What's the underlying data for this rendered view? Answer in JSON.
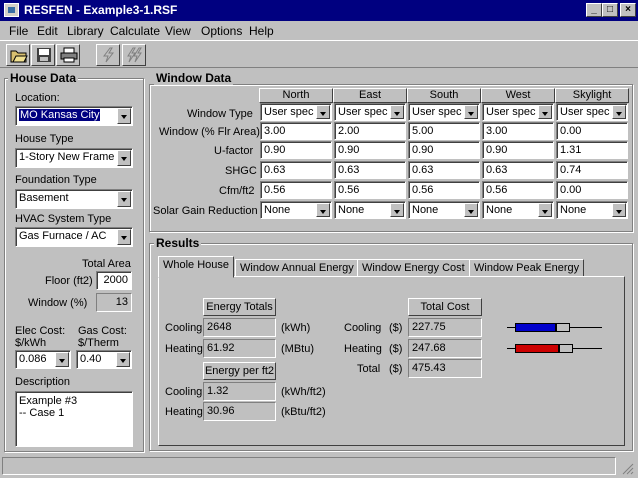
{
  "window": {
    "title": "RESFEN - Example3-1.RSF",
    "min": "_",
    "max": "□",
    "close": "×"
  },
  "menu": [
    "File",
    "Edit",
    "Library",
    "Calculate",
    "View",
    "Options",
    "Help"
  ],
  "toolbar": [
    "open-icon",
    "save-icon",
    "print-icon",
    "calculate-icon",
    "calculate-all-icon"
  ],
  "house": {
    "title": "House Data",
    "location_label": "Location:",
    "location_value": "MO Kansas City",
    "house_type_label": "House Type",
    "house_type_value": "1-Story New Frame",
    "foundation_label": "Foundation Type",
    "foundation_value": "Basement",
    "hvac_label": "HVAC System Type",
    "hvac_value": "Gas Furnace / AC",
    "total_area_label": "Total Area",
    "floor_label": "Floor (ft2)",
    "floor_value": "2000",
    "window_pct_label": "Window (%)",
    "window_pct_value": "13",
    "elec_cost_label": "Elec Cost:",
    "elec_unit": "$/kWh",
    "elec_value": "0.086",
    "gas_cost_label": "Gas Cost:",
    "gas_unit": "$/Therm",
    "gas_value": "0.40",
    "description_label": "Description",
    "description_lines": [
      "Example #3",
      "-- Case 1"
    ]
  },
  "windowdata": {
    "title": "Window Data",
    "columns": [
      "North",
      "East",
      "South",
      "West",
      "Skylight"
    ],
    "rows": [
      {
        "label": "Window Type",
        "values": [
          "User spec",
          "User spec",
          "User spec",
          "User spec",
          "User spec"
        ]
      },
      {
        "label": "Window (% Flr Area)",
        "values": [
          "3.00",
          "2.00",
          "5.00",
          "3.00",
          "0.00"
        ]
      },
      {
        "label": "U-factor",
        "values": [
          "0.90",
          "0.90",
          "0.90",
          "0.90",
          "1.31"
        ]
      },
      {
        "label": "SHGC",
        "values": [
          "0.63",
          "0.63",
          "0.63",
          "0.63",
          "0.74"
        ]
      },
      {
        "label": "Cfm/ft2",
        "values": [
          "0.56",
          "0.56",
          "0.56",
          "0.56",
          "0.00"
        ]
      },
      {
        "label": "Solar Gain Reduction",
        "values": [
          "None",
          "None",
          "None",
          "None",
          "None"
        ]
      }
    ]
  },
  "results": {
    "title": "Results",
    "tabs": [
      "Whole House",
      "Window Annual Energy",
      "Window Energy Cost",
      "Window Peak Energy"
    ],
    "energy_totals_label": "Energy Totals",
    "cooling_label": "Cooling",
    "heating_label": "Heating",
    "cooling_energy": "2648",
    "cooling_energy_unit": "(kWh)",
    "heating_energy": "61.92",
    "heating_energy_unit": "(MBtu)",
    "energy_per_ft2_label": "Energy per ft2",
    "cooling_per_ft2": "1.32",
    "cooling_per_ft2_unit": "(kWh/ft2)",
    "heating_per_ft2": "30.96",
    "heating_per_ft2_unit": "(kBtu/ft2)",
    "total_cost_label": "Total Cost",
    "cooling_cost_label": "Cooling",
    "heating_cost_label": "Heating",
    "total_label": "Total",
    "dollar_unit": "($)",
    "cooling_cost": "227.75",
    "heating_cost": "247.68",
    "total_cost": "475.43",
    "bar_colors": {
      "cooling": "#0000cc",
      "heating": "#cc0000"
    }
  }
}
